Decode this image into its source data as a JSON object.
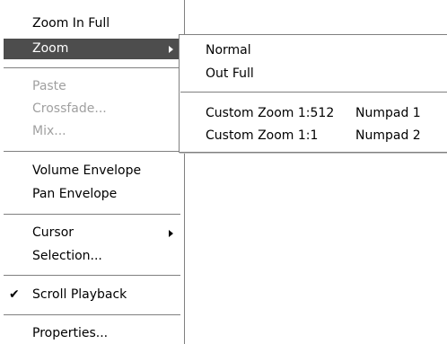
{
  "main_menu": {
    "items": [
      {
        "label": "Zoom In Full"
      },
      {
        "label": "Zoom",
        "submenu": true,
        "selected": true
      },
      {
        "label": "Paste",
        "disabled": true
      },
      {
        "label": "Crossfade...",
        "disabled": true
      },
      {
        "label": "Mix...",
        "disabled": true
      },
      {
        "label": "Volume Envelope"
      },
      {
        "label": "Pan Envelope"
      },
      {
        "label": "Cursor",
        "submenu": true
      },
      {
        "label": "Selection..."
      },
      {
        "label": "Scroll Playback",
        "checked": true
      },
      {
        "label": "Properties..."
      }
    ]
  },
  "zoom_submenu": {
    "items": [
      {
        "label": "Normal"
      },
      {
        "label": "Out Full"
      },
      {
        "label": "Custom Zoom 1:512",
        "shortcut": "Numpad 1"
      },
      {
        "label": "Custom Zoom 1:1",
        "shortcut": "Numpad 2"
      }
    ]
  },
  "colors": {
    "selected_bg": "#4d4d4d",
    "disabled_text": "#a0a0a0",
    "separator": "#808080"
  },
  "icons": {
    "submenu_arrow": "chevron-right-icon",
    "checkmark": "checkmark-icon"
  }
}
